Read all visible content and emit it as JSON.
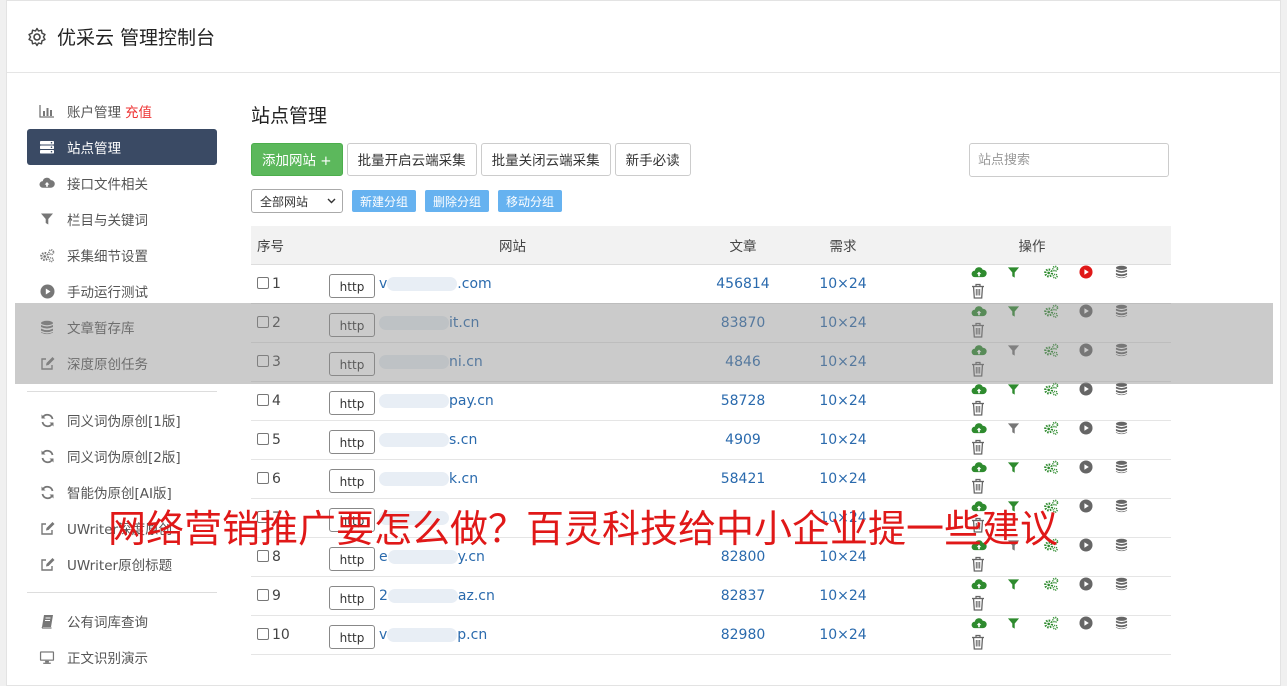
{
  "app": {
    "title": "优采云 管理控制台"
  },
  "sidebar": {
    "group1": [
      {
        "label": "账户管理",
        "extra": "充值",
        "icon": "bar-chart-icon"
      },
      {
        "label": "站点管理",
        "icon": "server-list-icon",
        "active": true
      },
      {
        "label": "接口文件相关",
        "icon": "cloud-upload-icon"
      },
      {
        "label": "栏目与关键词",
        "icon": "filter-icon"
      },
      {
        "label": "采集细节设置",
        "icon": "cogs-icon"
      },
      {
        "label": "手动运行测试",
        "icon": "play-icon"
      },
      {
        "label": "文章暂存库",
        "icon": "database-icon"
      },
      {
        "label": "深度原创任务",
        "icon": "edit-icon"
      }
    ],
    "group2": [
      {
        "label": "同义词伪原创[1版]",
        "icon": "refresh-icon"
      },
      {
        "label": "同义词伪原创[2版]",
        "icon": "refresh-icon"
      },
      {
        "label": "智能伪原创[AI版]",
        "icon": "refresh-icon"
      },
      {
        "label": "UWriter深度原创",
        "icon": "edit-icon"
      },
      {
        "label": "UWriter原创标题",
        "icon": "edit-icon"
      }
    ],
    "group3": [
      {
        "label": "公有词库查询",
        "icon": "book-icon"
      },
      {
        "label": "正文识别演示",
        "icon": "monitor-icon"
      }
    ]
  },
  "main": {
    "page_title": "站点管理",
    "toolbar": {
      "add_site": "添加网站 +",
      "batch_open": "批量开启云端采集",
      "batch_close": "批量关闭云端采集",
      "newbie": "新手必读"
    },
    "search_placeholder": "站点搜索",
    "group_select": "全部网站",
    "group_buttons": {
      "new": "新建分组",
      "delete": "删除分组",
      "move": "移动分组"
    },
    "table": {
      "headers": {
        "no": "序号",
        "site": "网站",
        "articles": "文章",
        "demand": "需求",
        "ops": "操作"
      },
      "rows": [
        {
          "no": "1",
          "proto": "http",
          "prefix": "v",
          "suffix": ".com",
          "articles": "456814",
          "demand": "10×24",
          "running": true,
          "filter_active": true
        },
        {
          "no": "2",
          "proto": "http",
          "prefix": "",
          "suffix": "it.cn",
          "articles": "83870",
          "demand": "10×24",
          "running": false,
          "filter_active": true
        },
        {
          "no": "3",
          "proto": "http",
          "prefix": "",
          "suffix": "ni.cn",
          "articles": "4846",
          "demand": "10×24",
          "running": false,
          "filter_active": false
        },
        {
          "no": "4",
          "proto": "http",
          "prefix": "",
          "suffix": "pay.cn",
          "articles": "58728",
          "demand": "10×24",
          "running": false,
          "filter_active": true
        },
        {
          "no": "5",
          "proto": "http",
          "prefix": "",
          "suffix": "s.cn",
          "articles": "4909",
          "demand": "10×24",
          "running": false,
          "filter_active": false
        },
        {
          "no": "6",
          "proto": "http",
          "prefix": "",
          "suffix": "k.cn",
          "articles": "58421",
          "demand": "10×24",
          "running": false,
          "filter_active": true
        },
        {
          "no": "7",
          "proto": "http",
          "prefix": "",
          "suffix": "",
          "articles": "",
          "demand": "10×24",
          "running": false,
          "filter_active": true
        },
        {
          "no": "8",
          "proto": "http",
          "prefix": "e",
          "suffix": "y.cn",
          "articles": "82800",
          "demand": "10×24",
          "running": false,
          "filter_active": false
        },
        {
          "no": "9",
          "proto": "http",
          "prefix": "2",
          "suffix": "az.cn",
          "articles": "82837",
          "demand": "10×24",
          "running": false,
          "filter_active": true
        },
        {
          "no": "10",
          "proto": "http",
          "prefix": "v",
          "suffix": "p.cn",
          "articles": "82980",
          "demand": "10×24",
          "running": false,
          "filter_active": true
        }
      ]
    }
  },
  "banner": "网络营销推广要怎么做？百灵科技给中小企业提一些建议",
  "colors": {
    "accent_green": "#5cb85c",
    "link_blue": "#2a6aad",
    "active_nav": "#3a4a64",
    "group_btn": "#66b2f0",
    "banner_red": "#e01818"
  }
}
